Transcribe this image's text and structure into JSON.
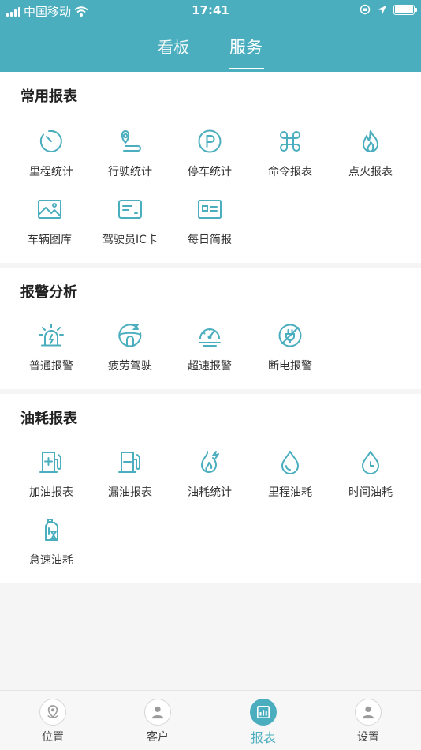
{
  "status_bar": {
    "carrier": "中国移动",
    "time": "17:41"
  },
  "top_tabs": {
    "inactive": "看板",
    "active": "服务"
  },
  "accent_color": "#4aaebe",
  "sections": [
    {
      "title": "常用报表",
      "items": [
        {
          "label": "里程统计",
          "icon": "timer-icon"
        },
        {
          "label": "行驶统计",
          "icon": "route-pin-icon"
        },
        {
          "label": "停车统计",
          "icon": "parking-icon"
        },
        {
          "label": "命令报表",
          "icon": "command-icon"
        },
        {
          "label": "点火报表",
          "icon": "flame-icon"
        },
        {
          "label": "车辆图库",
          "icon": "image-icon"
        },
        {
          "label": "驾驶员IC卡",
          "icon": "card-icon"
        },
        {
          "label": "每日简报",
          "icon": "id-card-icon"
        }
      ]
    },
    {
      "title": "报警分析",
      "items": [
        {
          "label": "普通报警",
          "icon": "alarm-light-icon"
        },
        {
          "label": "疲劳驾驶",
          "icon": "steering-wheel-icon"
        },
        {
          "label": "超速报警",
          "icon": "speedometer-icon"
        },
        {
          "label": "断电报警",
          "icon": "power-off-icon"
        }
      ]
    },
    {
      "title": "油耗报表",
      "items": [
        {
          "label": "加油报表",
          "icon": "fuel-add-icon"
        },
        {
          "label": "漏油报表",
          "icon": "fuel-leak-icon"
        },
        {
          "label": "油耗统计",
          "icon": "fuel-fire-icon"
        },
        {
          "label": "里程油耗",
          "icon": "drop-icon"
        },
        {
          "label": "时间油耗",
          "icon": "drop-clock-icon"
        },
        {
          "label": "怠速油耗",
          "icon": "oil-bottle-icon"
        }
      ]
    }
  ],
  "bottom_nav": [
    {
      "label": "位置",
      "icon": "location-icon"
    },
    {
      "label": "客户",
      "icon": "customer-icon"
    },
    {
      "label": "报表",
      "icon": "report-chart-icon",
      "active": true
    },
    {
      "label": "设置",
      "icon": "settings-user-icon"
    }
  ]
}
